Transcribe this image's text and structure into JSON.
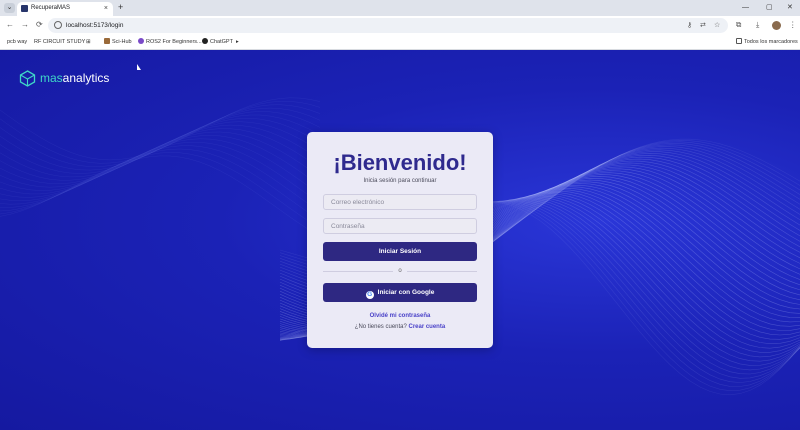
{
  "browser": {
    "tab_title": "RecuperaMAS",
    "tab_close": "×",
    "new_tab": "+",
    "menu_glyph": "⌄",
    "controls": {
      "minimize": "—",
      "maximize": "▢",
      "close": "✕"
    },
    "nav": {
      "back": "←",
      "forward": "→",
      "reload": "⟳"
    },
    "url": "localhost:5173/login",
    "bookmarks": [
      {
        "label": "pcb way"
      },
      {
        "label": "RF CIRCUIT STUDY"
      },
      {
        "label": "Sci-Hub"
      },
      {
        "label": "ROS2 For Beginners..."
      },
      {
        "label": "ChatGPT"
      }
    ],
    "all_bookmarks": "Todos los marcadores"
  },
  "brand": {
    "prefix": "mas",
    "suffix": "analytics",
    "accent": "#3fd7c7"
  },
  "login": {
    "title": "¡Bienvenido!",
    "subtitle": "Inicia sesión para continuar",
    "email_placeholder": "Correo electrónico",
    "password_placeholder": "Contraseña",
    "login_button": "Iniciar Sesión",
    "divider": "o",
    "google_button": "Iniciar con Google",
    "forgot_link": "Olvidé mi contraseña",
    "no_account_text": "¿No tienes cuenta?",
    "create_account_link": "Crear cuenta"
  },
  "colors": {
    "background": "#1a1fa8",
    "card": "#ebeaf6",
    "primary_button": "#2e2882",
    "title": "#2f2a8e",
    "link": "#4a42c8"
  }
}
